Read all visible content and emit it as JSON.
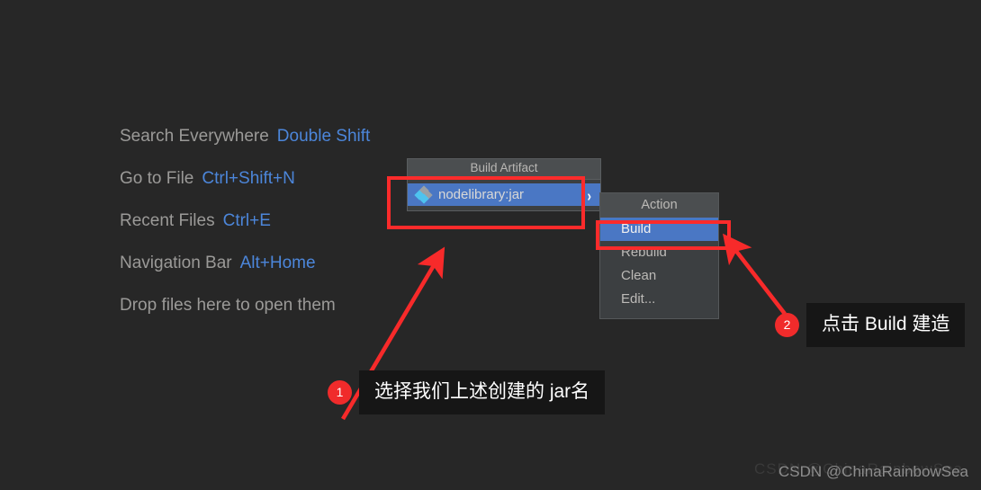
{
  "editor": {
    "hints": [
      {
        "label": "Search Everywhere",
        "key": "Double Shift"
      },
      {
        "label": "Go to File",
        "key": "Ctrl+Shift+N"
      },
      {
        "label": "Recent Files",
        "key": "Ctrl+E"
      },
      {
        "label": "Navigation Bar",
        "key": "Alt+Home"
      },
      {
        "label": "Drop files here to open them",
        "key": ""
      }
    ]
  },
  "artifact_popup": {
    "title": "Build Artifact",
    "item_label": "nodelibrary:jar",
    "chevron": "›",
    "icon_name": "artifact-diamond-icon"
  },
  "action_popup": {
    "title": "Action",
    "items": [
      {
        "label": "Build",
        "selected": true
      },
      {
        "label": "Rebuild",
        "selected": false
      },
      {
        "label": "Clean",
        "selected": false
      },
      {
        "label": "Edit...",
        "selected": false
      }
    ]
  },
  "annotations": [
    {
      "badge": "1",
      "text": "选择我们上述创建的 jar名"
    },
    {
      "badge": "2",
      "text": "点击 Build 建造"
    }
  ],
  "watermark": {
    "text": "CSDN @ChinaRainbowSea",
    "ghost": "CSDN @ChinaRainbowSea"
  },
  "colors": {
    "background": "#272727",
    "accent_red": "#fc2b2b",
    "selection_blue": "#4a77c4",
    "shortcut_blue": "#4c86da",
    "menu_panel": "#3c3f41",
    "menu_header": "#4b4e50",
    "label_gray": "#9b9a98"
  }
}
